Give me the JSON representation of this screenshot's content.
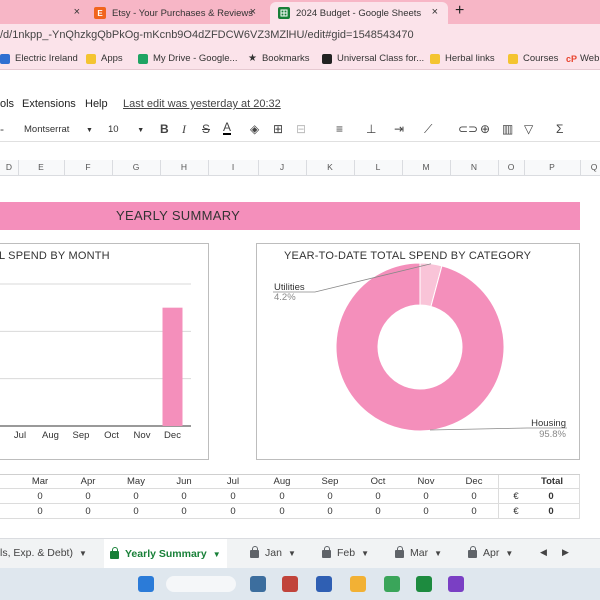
{
  "browser": {
    "tabs": [
      {
        "title": "",
        "favicon": "",
        "color": "#f7b6c6"
      },
      {
        "title": "Etsy - Your Purchases & Reviews",
        "favicon": "E",
        "color": "#f1641e"
      },
      {
        "title": "2024 Budget - Google Sheets",
        "favicon": "",
        "color": "#188038"
      }
    ],
    "new_tab": "+",
    "close": "×",
    "url": "/d/1nkpp_-YnQhzkgQbPkOg-mKcnb9O4dZFDCW6VZ3MZlHU/edit#gid=1548543470",
    "bookmarks": [
      {
        "label": "Electric Ireland",
        "color": "#2f6fd1"
      },
      {
        "label": "Apps",
        "color": "#f4c430"
      },
      {
        "label": "My Drive - Google...",
        "color": "#1fa463"
      },
      {
        "label": "Bookmarks",
        "color": "#222222"
      },
      {
        "label": "Universal Class for...",
        "color": "#222222"
      },
      {
        "label": "Herbal links",
        "color": "#f4c430"
      },
      {
        "label": "Courses",
        "color": "#f4c430"
      },
      {
        "label": "Web",
        "color": "#e8432d",
        "icon": "cP"
      }
    ]
  },
  "menu": {
    "items": [
      "ols",
      "Extensions",
      "Help"
    ],
    "last_edit": "Last edit was yesterday at 20:32"
  },
  "toolbar": {
    "font": "Montserrat",
    "size": "10",
    "bold": "B",
    "italic": "I",
    "strike": "S",
    "underline_a": "A"
  },
  "columns": [
    "D",
    "E",
    "F",
    "G",
    "H",
    "I",
    "J",
    "K",
    "L",
    "M",
    "N",
    "O",
    "P",
    "Q"
  ],
  "sheet": {
    "banner": "YEARLY SUMMARY",
    "chart1_title": "L SPEND BY MONTH",
    "chart2_title": "YEAR-TO-DATE TOTAL SPEND BY CATEGORY"
  },
  "chart_data": [
    {
      "type": "bar",
      "title": "L SPEND BY MONTH",
      "categories": [
        "Jul",
        "Aug",
        "Sep",
        "Oct",
        "Nov",
        "Dec"
      ],
      "values": [
        0,
        0,
        0,
        0,
        0,
        1
      ],
      "ylim": [
        0,
        1.2
      ],
      "grid": true,
      "color": "#f48fbb"
    },
    {
      "type": "pie",
      "title": "YEAR-TO-DATE TOTAL SPEND BY CATEGORY",
      "donut": true,
      "slices": [
        {
          "label": "Housing",
          "value": 95.8,
          "display": "95.8%",
          "color": "#f48fbb"
        },
        {
          "label": "Utilities",
          "value": 4.2,
          "display": "4.2%",
          "color": "#f9c4d8"
        }
      ]
    }
  ],
  "table": {
    "months": [
      "Mar",
      "Apr",
      "May",
      "Jun",
      "Jul",
      "Aug",
      "Sep",
      "Oct",
      "Nov",
      "Dec"
    ],
    "total_label": "Total",
    "rows": [
      {
        "values": [
          "0",
          "0",
          "0",
          "0",
          "0",
          "0",
          "0",
          "0",
          "0",
          "0"
        ],
        "currency": "€",
        "total": "0"
      },
      {
        "values": [
          "0",
          "0",
          "0",
          "0",
          "0",
          "0",
          "0",
          "0",
          "0",
          "0"
        ],
        "currency": "€",
        "total": "0"
      }
    ]
  },
  "sheet_tabs": [
    {
      "label": "ls, Exp. & Debt)",
      "locked": false,
      "active": false
    },
    {
      "label": "Yearly Summary",
      "locked": true,
      "active": true
    },
    {
      "label": "Jan",
      "locked": true,
      "active": false
    },
    {
      "label": "Feb",
      "locked": true,
      "active": false
    },
    {
      "label": "Mar",
      "locked": true,
      "active": false
    },
    {
      "label": "Apr",
      "locked": true,
      "active": false
    }
  ]
}
